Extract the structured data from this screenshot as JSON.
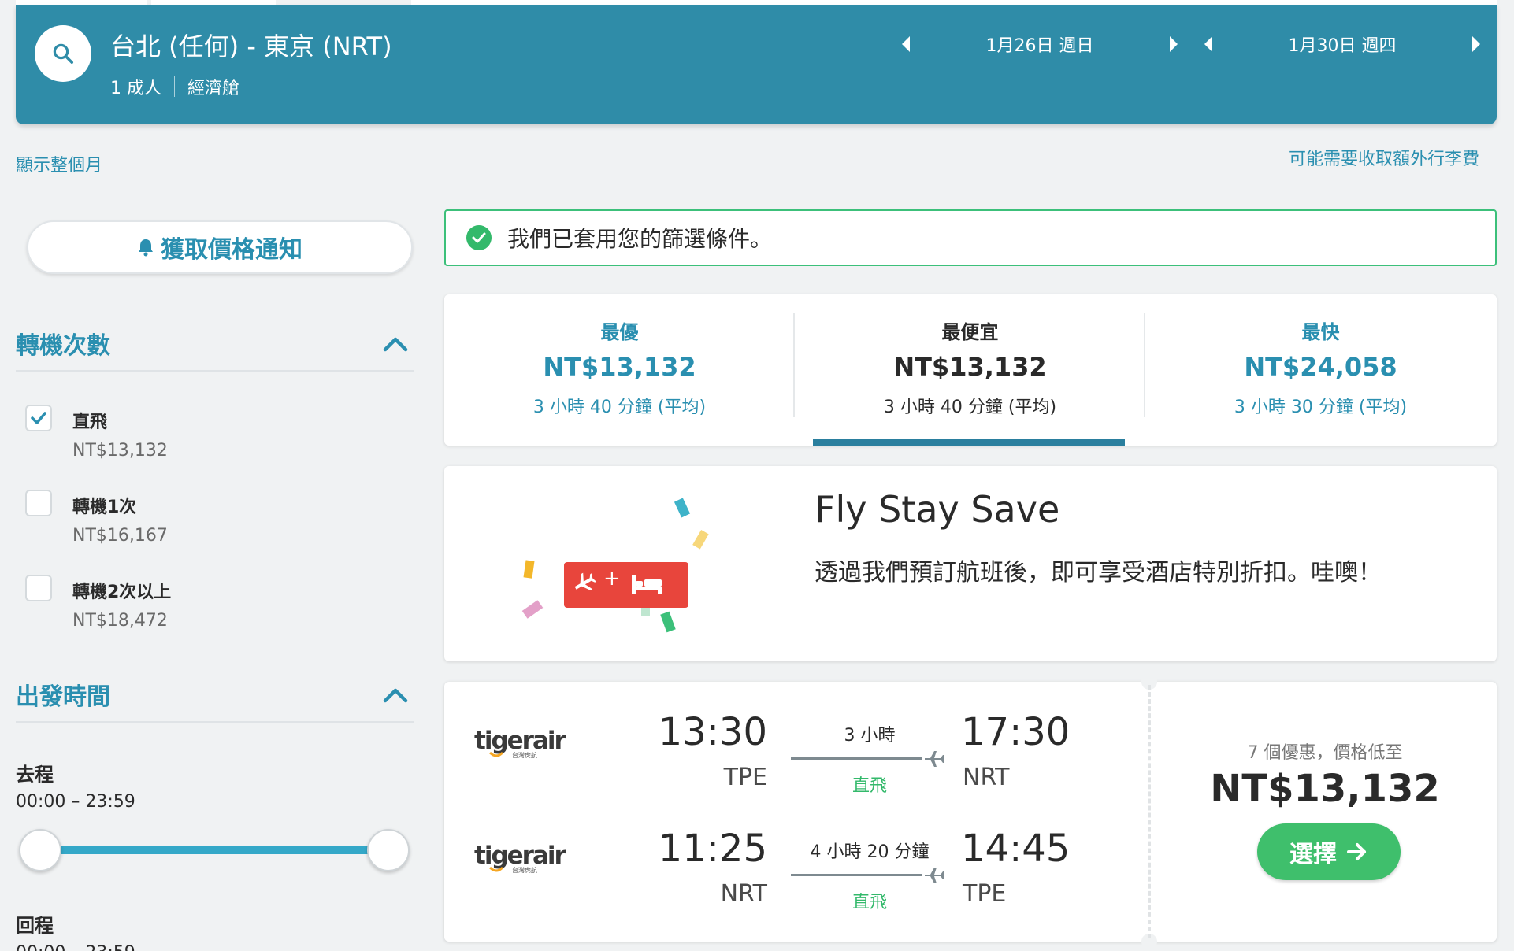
{
  "header": {
    "route": "台北 (任何) - 東京 (NRT)",
    "passengers": "1 成人",
    "cabin": "經濟艙",
    "depart_date": "1月26日 週日",
    "return_date": "1月30日 週四"
  },
  "links": {
    "show_month": "顯示整個月",
    "baggage_fee": "可能需要收取額外行李費"
  },
  "sidebar": {
    "price_alert": "獲取價格通知",
    "stops": {
      "title": "轉機次數",
      "options": [
        {
          "label": "直飛",
          "price": "NT$13,132",
          "checked": true
        },
        {
          "label": "轉機1次",
          "price": "NT$16,167",
          "checked": false
        },
        {
          "label": "轉機2次以上",
          "price": "NT$18,472",
          "checked": false
        }
      ]
    },
    "departure_time": {
      "title": "出發時間",
      "outbound_label": "去程",
      "outbound_range": "00:00 – 23:59",
      "return_label": "回程",
      "return_range": "00:00 – 23:59"
    }
  },
  "filter_banner": "我們已套用您的篩選條件。",
  "sort_tabs": [
    {
      "label": "最優",
      "price": "NT$13,132",
      "duration": "3 小時 40 分鐘 (平均)"
    },
    {
      "label": "最便宜",
      "price": "NT$13,132",
      "duration": "3 小時 40 分鐘 (平均)"
    },
    {
      "label": "最快",
      "price": "NT$24,058",
      "duration": "3 小時 30 分鐘 (平均)"
    }
  ],
  "promo": {
    "title": "Fly Stay Save",
    "text": "透過我們預訂航班後，即可享受酒店特別折扣。哇噢！",
    "badge_plus": "+"
  },
  "flight": {
    "legs": [
      {
        "airline": "tigerair",
        "airline_sub": "台灣虎航",
        "depart_time": "13:30",
        "depart_code": "TPE",
        "duration": "3 小時",
        "stops": "直飛",
        "arrive_time": "17:30",
        "arrive_code": "NRT"
      },
      {
        "airline": "tigerair",
        "airline_sub": "台灣虎航",
        "depart_time": "11:25",
        "depart_code": "NRT",
        "duration": "4 小時 20 分鐘",
        "stops": "直飛",
        "arrive_time": "14:45",
        "arrive_code": "TPE"
      }
    ],
    "deals": "7 個優惠，價格低至",
    "price": "NT$13,132",
    "select_label": "選擇"
  },
  "colors": {
    "header_bg": "#2f8ca8",
    "link": "#2a8fb0",
    "success": "#33b96b",
    "select_button": "#3fbf6c",
    "promo_red": "#e8453c"
  }
}
